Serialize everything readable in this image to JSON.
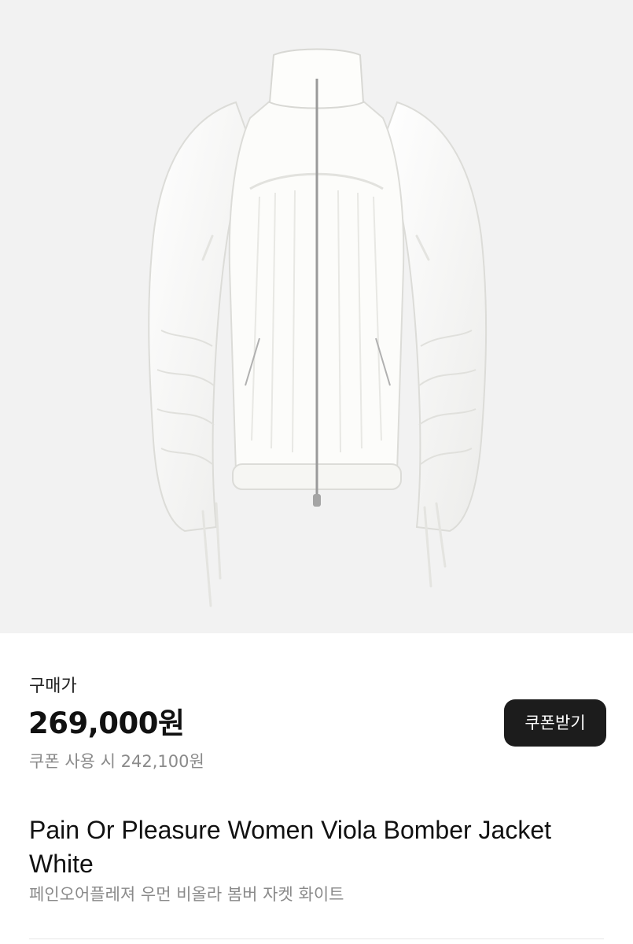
{
  "product": {
    "image_alt": "Pain Or Pleasure Women Viola Bomber Jacket White",
    "price_label": "구매가",
    "price": "269,000원",
    "coupon_price": "쿠폰 사용 시 242,100원",
    "coupon_button_label": "쿠폰받기",
    "title": "Pain Or Pleasure Women Viola Bomber Jacket White",
    "subtitle": "페인오어플레져 우먼 비올라 봄버 자켓 화이트"
  },
  "colors": {
    "image_background": "#f2f2f2",
    "jacket": "#fbfbf9",
    "button": "#1c1c1c",
    "muted_text": "#8a8a8a"
  }
}
